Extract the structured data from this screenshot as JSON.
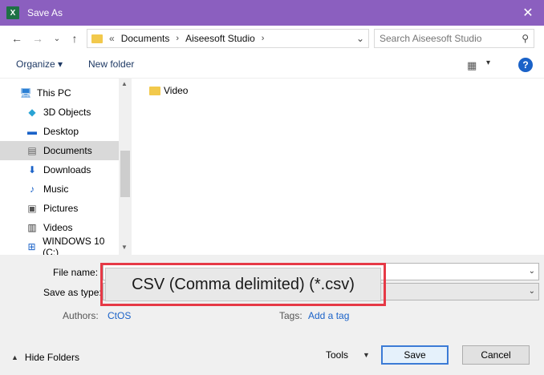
{
  "window": {
    "title": "Save As",
    "app_icon": "X"
  },
  "nav": {
    "path": [
      "Documents",
      "Aiseesoft Studio"
    ],
    "path_prefix": "«",
    "search_placeholder": "Search Aiseesoft Studio"
  },
  "toolbar": {
    "organize": "Organize ▾",
    "new_folder": "New folder"
  },
  "sidebar": {
    "items": [
      {
        "label": "This PC",
        "icon": "pc-icon"
      },
      {
        "label": "3D Objects",
        "icon": "cube-icon"
      },
      {
        "label": "Desktop",
        "icon": "desktop-icon"
      },
      {
        "label": "Documents",
        "icon": "documents-icon"
      },
      {
        "label": "Downloads",
        "icon": "download-icon"
      },
      {
        "label": "Music",
        "icon": "music-icon"
      },
      {
        "label": "Pictures",
        "icon": "pictures-icon"
      },
      {
        "label": "Videos",
        "icon": "videos-icon"
      },
      {
        "label": "WINDOWS 10 (C:)",
        "icon": "drive-icon"
      }
    ],
    "selected": "Documents"
  },
  "files": [
    {
      "name": "Video",
      "type": "folder"
    }
  ],
  "form": {
    "file_name_label": "File name:",
    "file_name_value": "",
    "save_type_label": "Save as type:",
    "save_type_value": "CSV (Comma delimited) (*.csv)",
    "authors_label": "Authors:",
    "authors_value": "CtOS",
    "tags_label": "Tags:",
    "tags_value": "Add a tag"
  },
  "footer": {
    "hide_folders": "Hide Folders",
    "tools": "Tools",
    "save": "Save",
    "cancel": "Cancel"
  },
  "colors": {
    "titlebar": "#8b5fbf",
    "highlight": "#e63946",
    "link": "#1a62c8"
  }
}
